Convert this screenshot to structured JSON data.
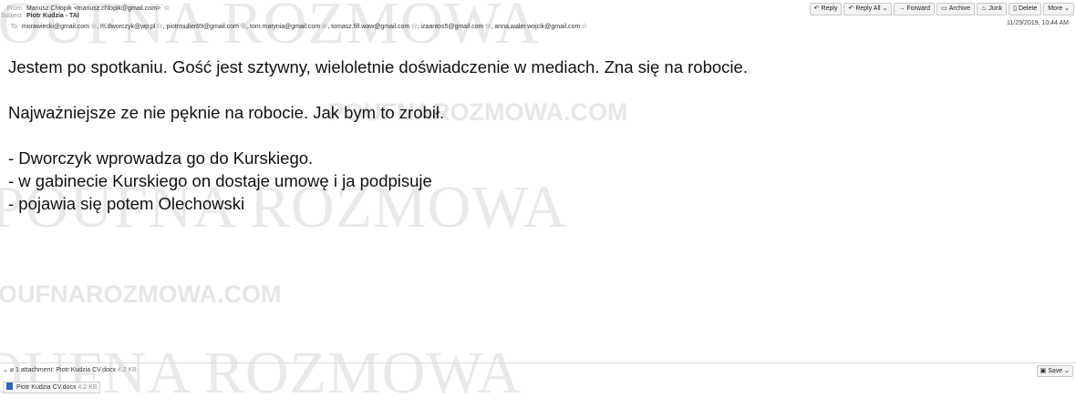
{
  "watermark": {
    "serif_text": "POUFNA ROZMOWA",
    "sans_text": "POUFNAROZMOWA.COM"
  },
  "header": {
    "from_label": "From",
    "from_value": "Mariusz Chłopik <mariusz.chlopik@gmail.com>",
    "subject_label": "Subject",
    "subject_value": "Piotr Kudzia - TAI",
    "to_label": "To",
    "recipients": [
      "morawiecki@gmail.com",
      "m.dworczyk@wp.pl",
      "piotrmuller89@gmail.com",
      "tom.matynia@gmail.com",
      "tomasz.fill.waw@gmail.com",
      "izaantos5@gmail.com",
      "anna.waler.wojcik@gmail.com"
    ],
    "date": "11/29/2019, 10:44 AM"
  },
  "toolbar": {
    "reply": "Reply",
    "reply_all": "Reply All",
    "forward": "Forward",
    "archive": "Archive",
    "junk": "Junk",
    "delete": "Delete",
    "more": "More"
  },
  "message": {
    "line1": "Jestem po spotkaniu. Gość jest sztywny, wieloletnie doświadczenie w mediach. Zna się na robocie.",
    "line2": "Najważniejsze ze nie pęknie na robocie. Jak bym to zrobił.",
    "line3": "- Dworczyk wprowadza go do Kurskiego.",
    "line4": "- w gabinecie Kurskiego on dostaje umowę i ja podpisuje",
    "line5": "- pojawia się potem Olechowski"
  },
  "attachments": {
    "summary": "1 attachment: Piotr Kudzia CV.docx",
    "summary_size": "4.2 KB",
    "save": "Save",
    "file_name": "Piotr Kudzia CV.docx",
    "file_size": "4.2 KB"
  },
  "icons": {
    "reply": "reply-arrow-icon",
    "star": "star-outline-icon",
    "file": "word-document-icon"
  }
}
